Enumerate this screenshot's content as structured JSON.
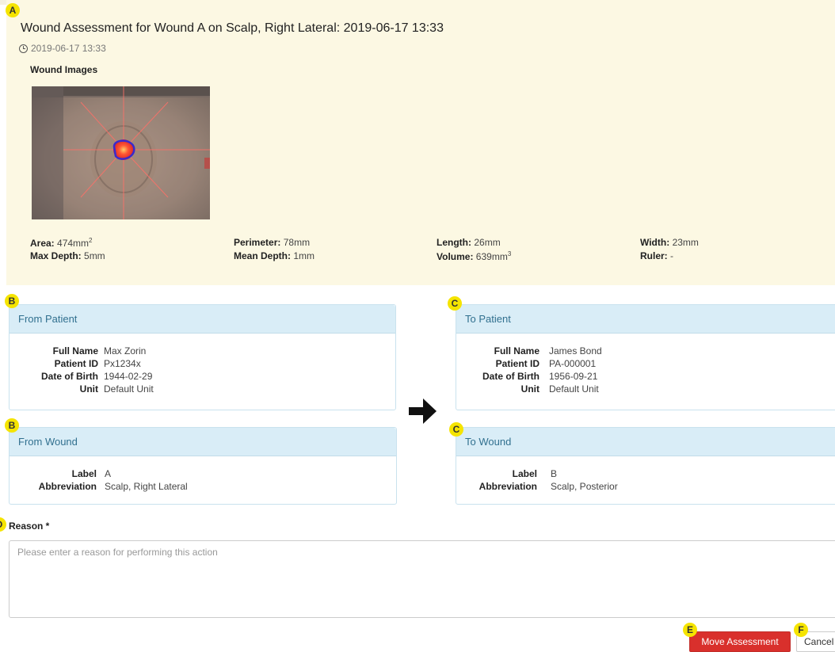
{
  "assessment": {
    "title": "Wound Assessment for Wound A on Scalp, Right Lateral: 2019-06-17 13:33",
    "timestamp": "2019-06-17 13:33",
    "images_heading": "Wound Images",
    "metrics": {
      "area_label": "Area:",
      "area_value": "474mm",
      "area_sup": "2",
      "max_depth_label": "Max Depth:",
      "max_depth_value": "5mm",
      "perimeter_label": "Perimeter:",
      "perimeter_value": "78mm",
      "mean_depth_label": "Mean Depth:",
      "mean_depth_value": "1mm",
      "length_label": "Length:",
      "length_value": "26mm",
      "volume_label": "Volume:",
      "volume_value": "639mm",
      "volume_sup": "3",
      "width_label": "Width:",
      "width_value": "23mm",
      "ruler_label": "Ruler:",
      "ruler_value": "-"
    }
  },
  "markers": {
    "a": "A",
    "b": "B",
    "c": "C",
    "d": "D",
    "e": "E",
    "f": "F"
  },
  "from_patient": {
    "title": "From Patient",
    "full_name_label": "Full Name",
    "full_name": "Max Zorin",
    "patient_id_label": "Patient ID",
    "patient_id": "Px1234x",
    "dob_label": "Date of Birth",
    "dob": "1944-02-29",
    "unit_label": "Unit",
    "unit": "Default Unit"
  },
  "to_patient": {
    "title": "To Patient",
    "full_name_label": "Full Name",
    "full_name": "James Bond",
    "patient_id_label": "Patient ID",
    "patient_id": "PA-000001",
    "dob_label": "Date of Birth",
    "dob": "1956-09-21",
    "unit_label": "Unit",
    "unit": "Default Unit"
  },
  "from_wound": {
    "title": "From Wound",
    "label_label": "Label",
    "label": "A",
    "abbreviation_label": "Abbreviation",
    "abbreviation": "Scalp, Right Lateral"
  },
  "to_wound": {
    "title": "To Wound",
    "label_label": "Label",
    "label": "B",
    "abbreviation_label": "Abbreviation",
    "abbreviation": "Scalp, Posterior"
  },
  "reason": {
    "label": "Reason *",
    "placeholder": "Please enter a reason for performing this action"
  },
  "actions": {
    "move_label": "Move Assessment",
    "cancel_label": "Cancel"
  },
  "colors": {
    "assessment_bg": "#fcf8e3",
    "panel_header_bg": "#d9edf7",
    "panel_header_text": "#31708f",
    "danger": "#d9302c",
    "marker": "#f5e400"
  }
}
